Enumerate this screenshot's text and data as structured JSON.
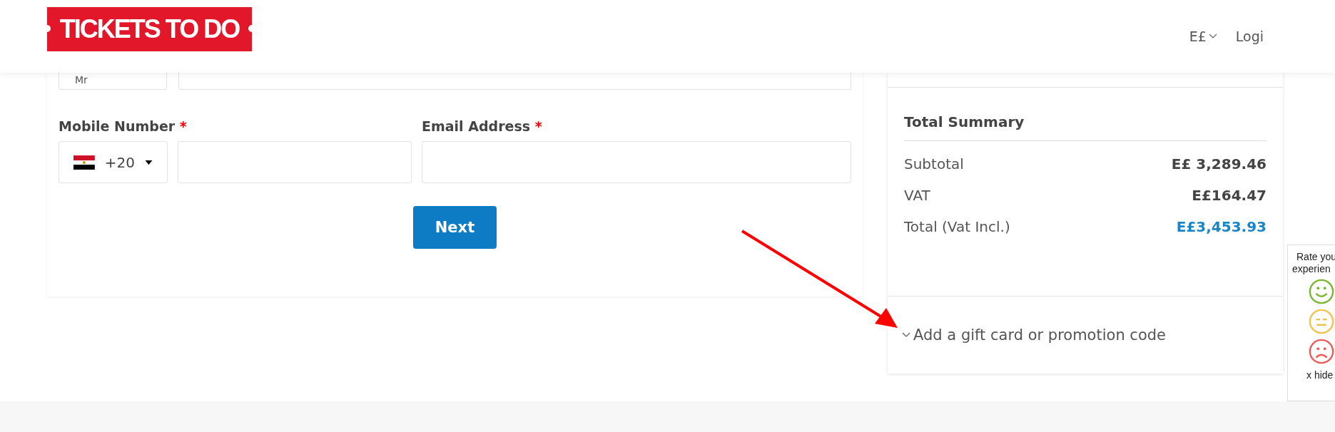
{
  "header": {
    "logo": "TICKETS TO DO",
    "currency": "E£",
    "login": "Logi"
  },
  "form": {
    "title_value": "Mr",
    "mobile": {
      "label": "Mobile Number",
      "required_mark": "*",
      "country_code": "+20"
    },
    "email": {
      "label": "Email Address",
      "required_mark": "*"
    },
    "next_button": "Next"
  },
  "summary": {
    "title": "Total Summary",
    "rows": [
      {
        "label": "Subtotal",
        "amount": "E£ 3,289.46",
        "kind": "normal"
      },
      {
        "label": "VAT",
        "amount": "E£164.47",
        "kind": "normal"
      },
      {
        "label": "Total (Vat Incl.)",
        "amount": "E£3,453.93",
        "kind": "total"
      }
    ],
    "promo": {
      "label": "Add a gift card or promotion code",
      "expanded": false
    }
  },
  "feedback": {
    "prompt_lines": [
      "Rate you",
      "experien"
    ],
    "hide": "x hide"
  }
}
